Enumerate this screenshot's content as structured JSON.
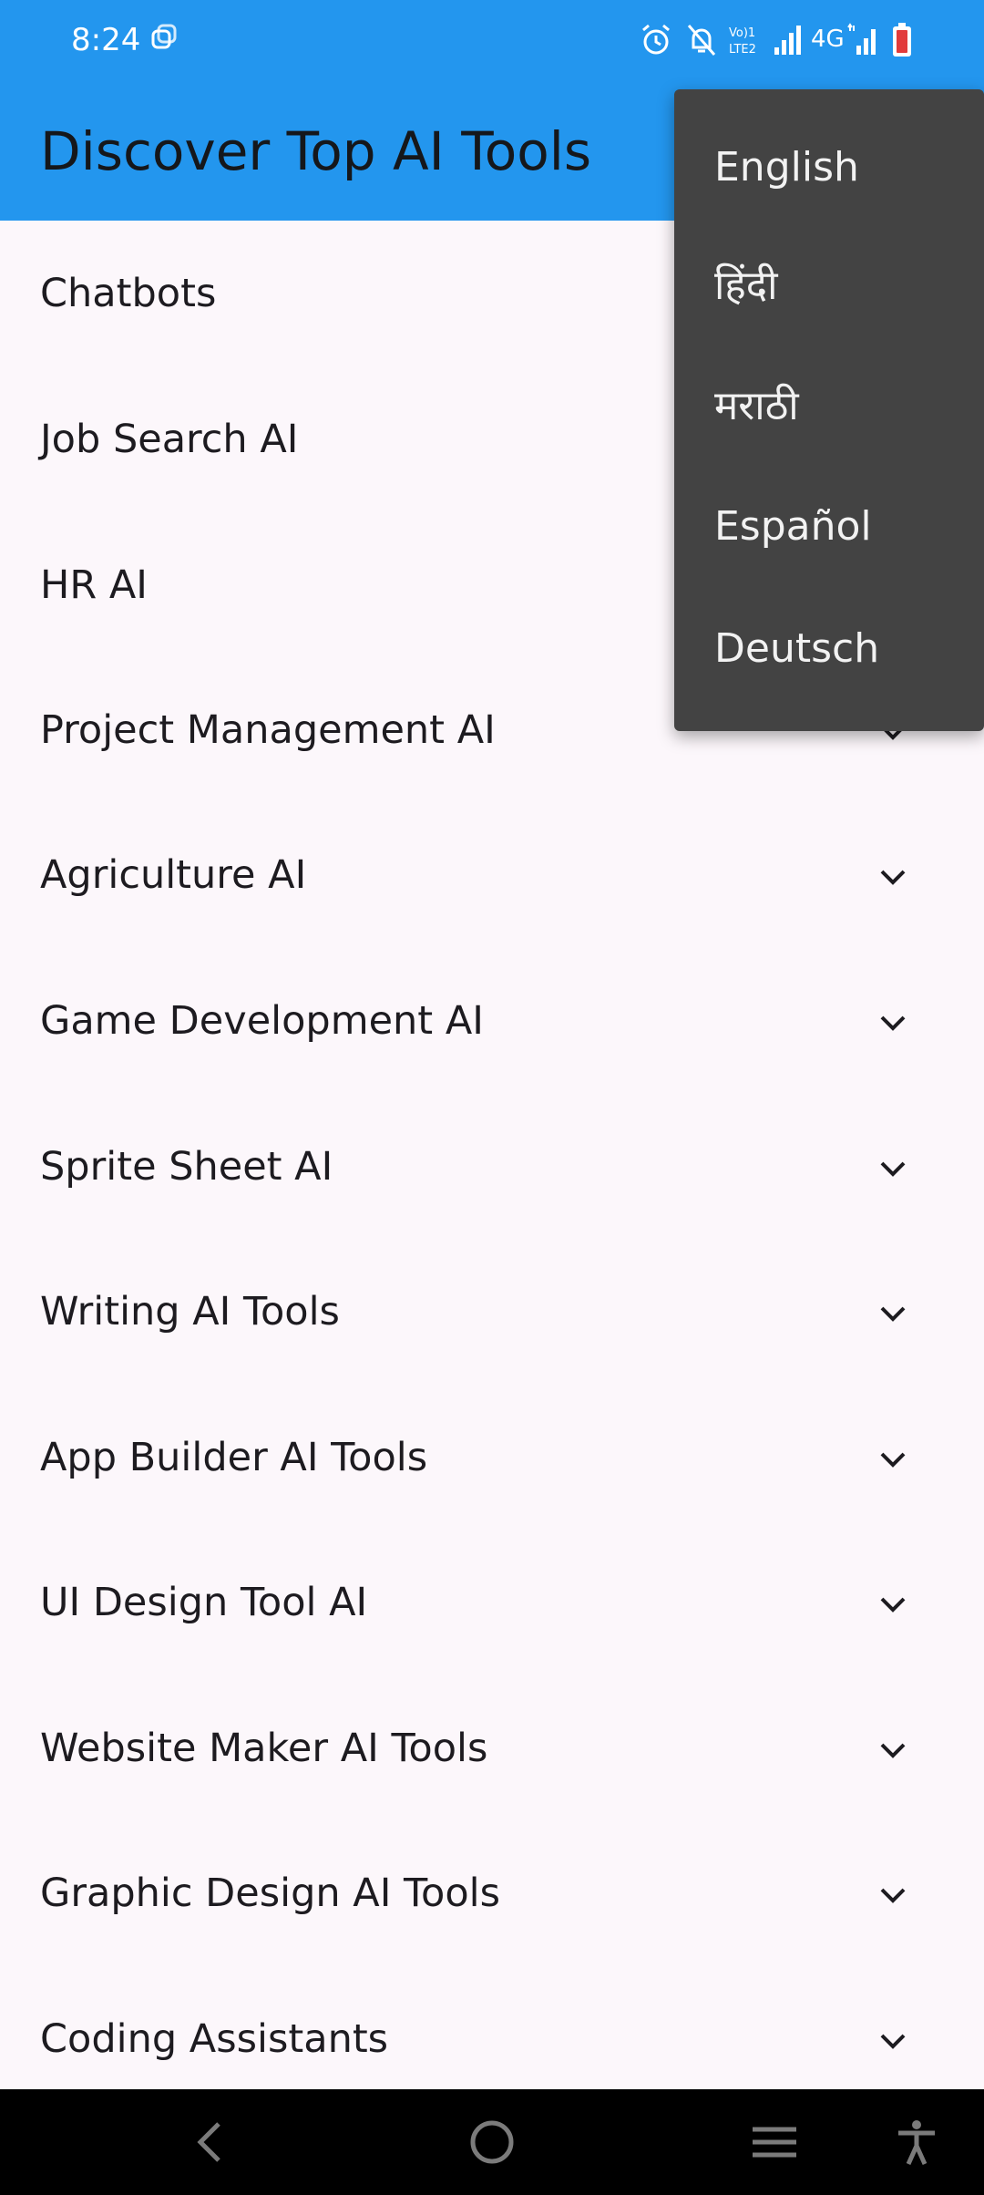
{
  "status_bar": {
    "time": "8:24",
    "network_label": "4G",
    "icons": [
      "sync-icon",
      "alarm-icon",
      "notifications-off-icon",
      "volte-icon",
      "signal-icon",
      "signal-icon",
      "battery-low-icon"
    ]
  },
  "app_bar": {
    "title": "Discover Top AI Tools"
  },
  "categories": [
    {
      "label": "Chatbots"
    },
    {
      "label": "Job Search AI"
    },
    {
      "label": "HR AI"
    },
    {
      "label": "Project Management AI"
    },
    {
      "label": "Agriculture AI"
    },
    {
      "label": "Game Development AI"
    },
    {
      "label": "Sprite Sheet AI"
    },
    {
      "label": "Writing AI Tools"
    },
    {
      "label": "App Builder AI Tools"
    },
    {
      "label": "UI Design Tool AI"
    },
    {
      "label": "Website Maker AI Tools"
    },
    {
      "label": "Graphic Design AI Tools"
    },
    {
      "label": "Coding Assistants"
    }
  ],
  "language_menu": {
    "items": [
      "English",
      "हिंदी",
      "मराठी",
      "Español",
      "Deutsch"
    ]
  },
  "nav_bar": {
    "icons": [
      "back-icon",
      "home-icon",
      "recents-icon",
      "accessibility-icon"
    ]
  },
  "colors": {
    "primary": "#2396ee",
    "background": "#fcf7fb",
    "menu_background": "#434343"
  }
}
